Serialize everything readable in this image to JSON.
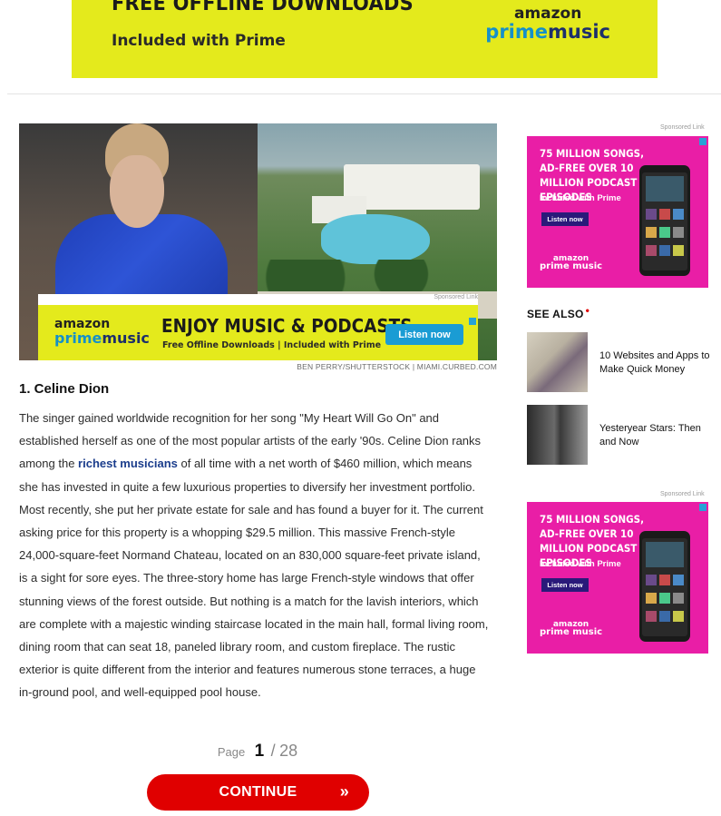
{
  "top_ad": {
    "headline": "FREE OFFLINE DOWNLOADS",
    "subtext": "Included with Prime",
    "logo_top": "amazon",
    "logo_prime": "prime",
    "logo_music": "music"
  },
  "hero": {
    "credit": "BEN PERRY/SHUTTERSTOCK | MIAMI.CURBED.COM"
  },
  "inline_ad": {
    "sponsored": "Sponsored Link",
    "logo_top": "amazon",
    "logo_prime": "prime",
    "logo_music": "music",
    "headline": "ENJOY MUSIC & PODCASTS",
    "subtext": "Free Offline Downloads | Included with Prime",
    "button": "Listen now"
  },
  "article": {
    "title": "1. Celine Dion",
    "p_before_link": "The singer gained worldwide recognition for her song \"My Heart Will Go On\" and established herself as one of the most popular artists of the early '90s. Celine Dion ranks among the ",
    "link": "richest musicians",
    "p_after_link": " of all time with a net worth of $460 million, which means she has invested in quite a few luxurious properties to diversify her investment portfolio. Most recently, she put her private estate for sale and has found a buyer for it. The current asking price for this property is a whopping $29.5 million. This massive French-style 24,000-square-feet Normand Chateau, located on an 830,000 square-feet private island, is a sight for sore eyes. The three-story home has large French-style windows that offer stunning views of the forest outside. But nothing is a match for the lavish interiors, which are complete with a majestic winding staircase located in the main hall, formal living room, dining room that can seat 18, paneled library room, and custom fireplace. The rustic exterior is quite different from the interior and features numerous stone terraces, a huge in-ground pool, and well-equipped pool house."
  },
  "pager": {
    "label": "Page",
    "current": "1",
    "separator": "/",
    "total": "28"
  },
  "continue": {
    "label": "CONTINUE",
    "arrow": "»"
  },
  "sidebar": {
    "ad1": {
      "sponsored": "Sponsored Link",
      "headline": "75 MILLION SONGS, AD-FREE OVER 10 MILLION PODCAST EPISODES",
      "included": "Included with Prime",
      "button": "Listen now",
      "logo_top": "amazon",
      "logo_bottom": "prime music"
    },
    "see_also": {
      "title": "SEE ALSO",
      "dot": "•",
      "items": [
        {
          "label": "10 Websites and Apps to Make Quick Money"
        },
        {
          "label": "Yesteryear Stars: Then and Now"
        }
      ]
    },
    "ad2": {
      "sponsored": "Sponsored Link",
      "headline": "75 MILLION SONGS, AD-FREE OVER 10 MILLION PODCAST EPISODES",
      "included": "Included with Prime",
      "button": "Listen now",
      "logo_top": "amazon",
      "logo_bottom": "prime music"
    }
  },
  "colors": {
    "ad_yellow": "#e4ea1c",
    "ad_pink": "#e91ea6",
    "continue_red": "#e00000",
    "link_blue": "#1b3d8c"
  }
}
